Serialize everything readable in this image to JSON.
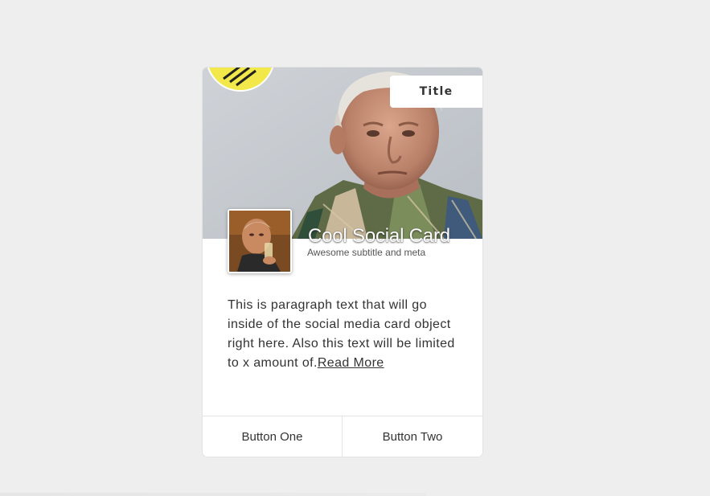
{
  "card": {
    "tab_label": "Title",
    "title": "Cool Social Card",
    "subtitle": "Awesome subtitle and meta",
    "body_text": "This is paragraph text that will go inside of the social media card object right here. Also this text will be limited to x amount of.",
    "read_more": "Read More",
    "buttons": {
      "one": "Button One",
      "two": "Button Two"
    }
  },
  "colors": {
    "page_background": "#eeeeee",
    "card_background": "#ffffff",
    "badge_yellow": "#f2e84a",
    "text": "#333333"
  },
  "icons": {
    "badge": "yellow-circle-badge-icon"
  }
}
